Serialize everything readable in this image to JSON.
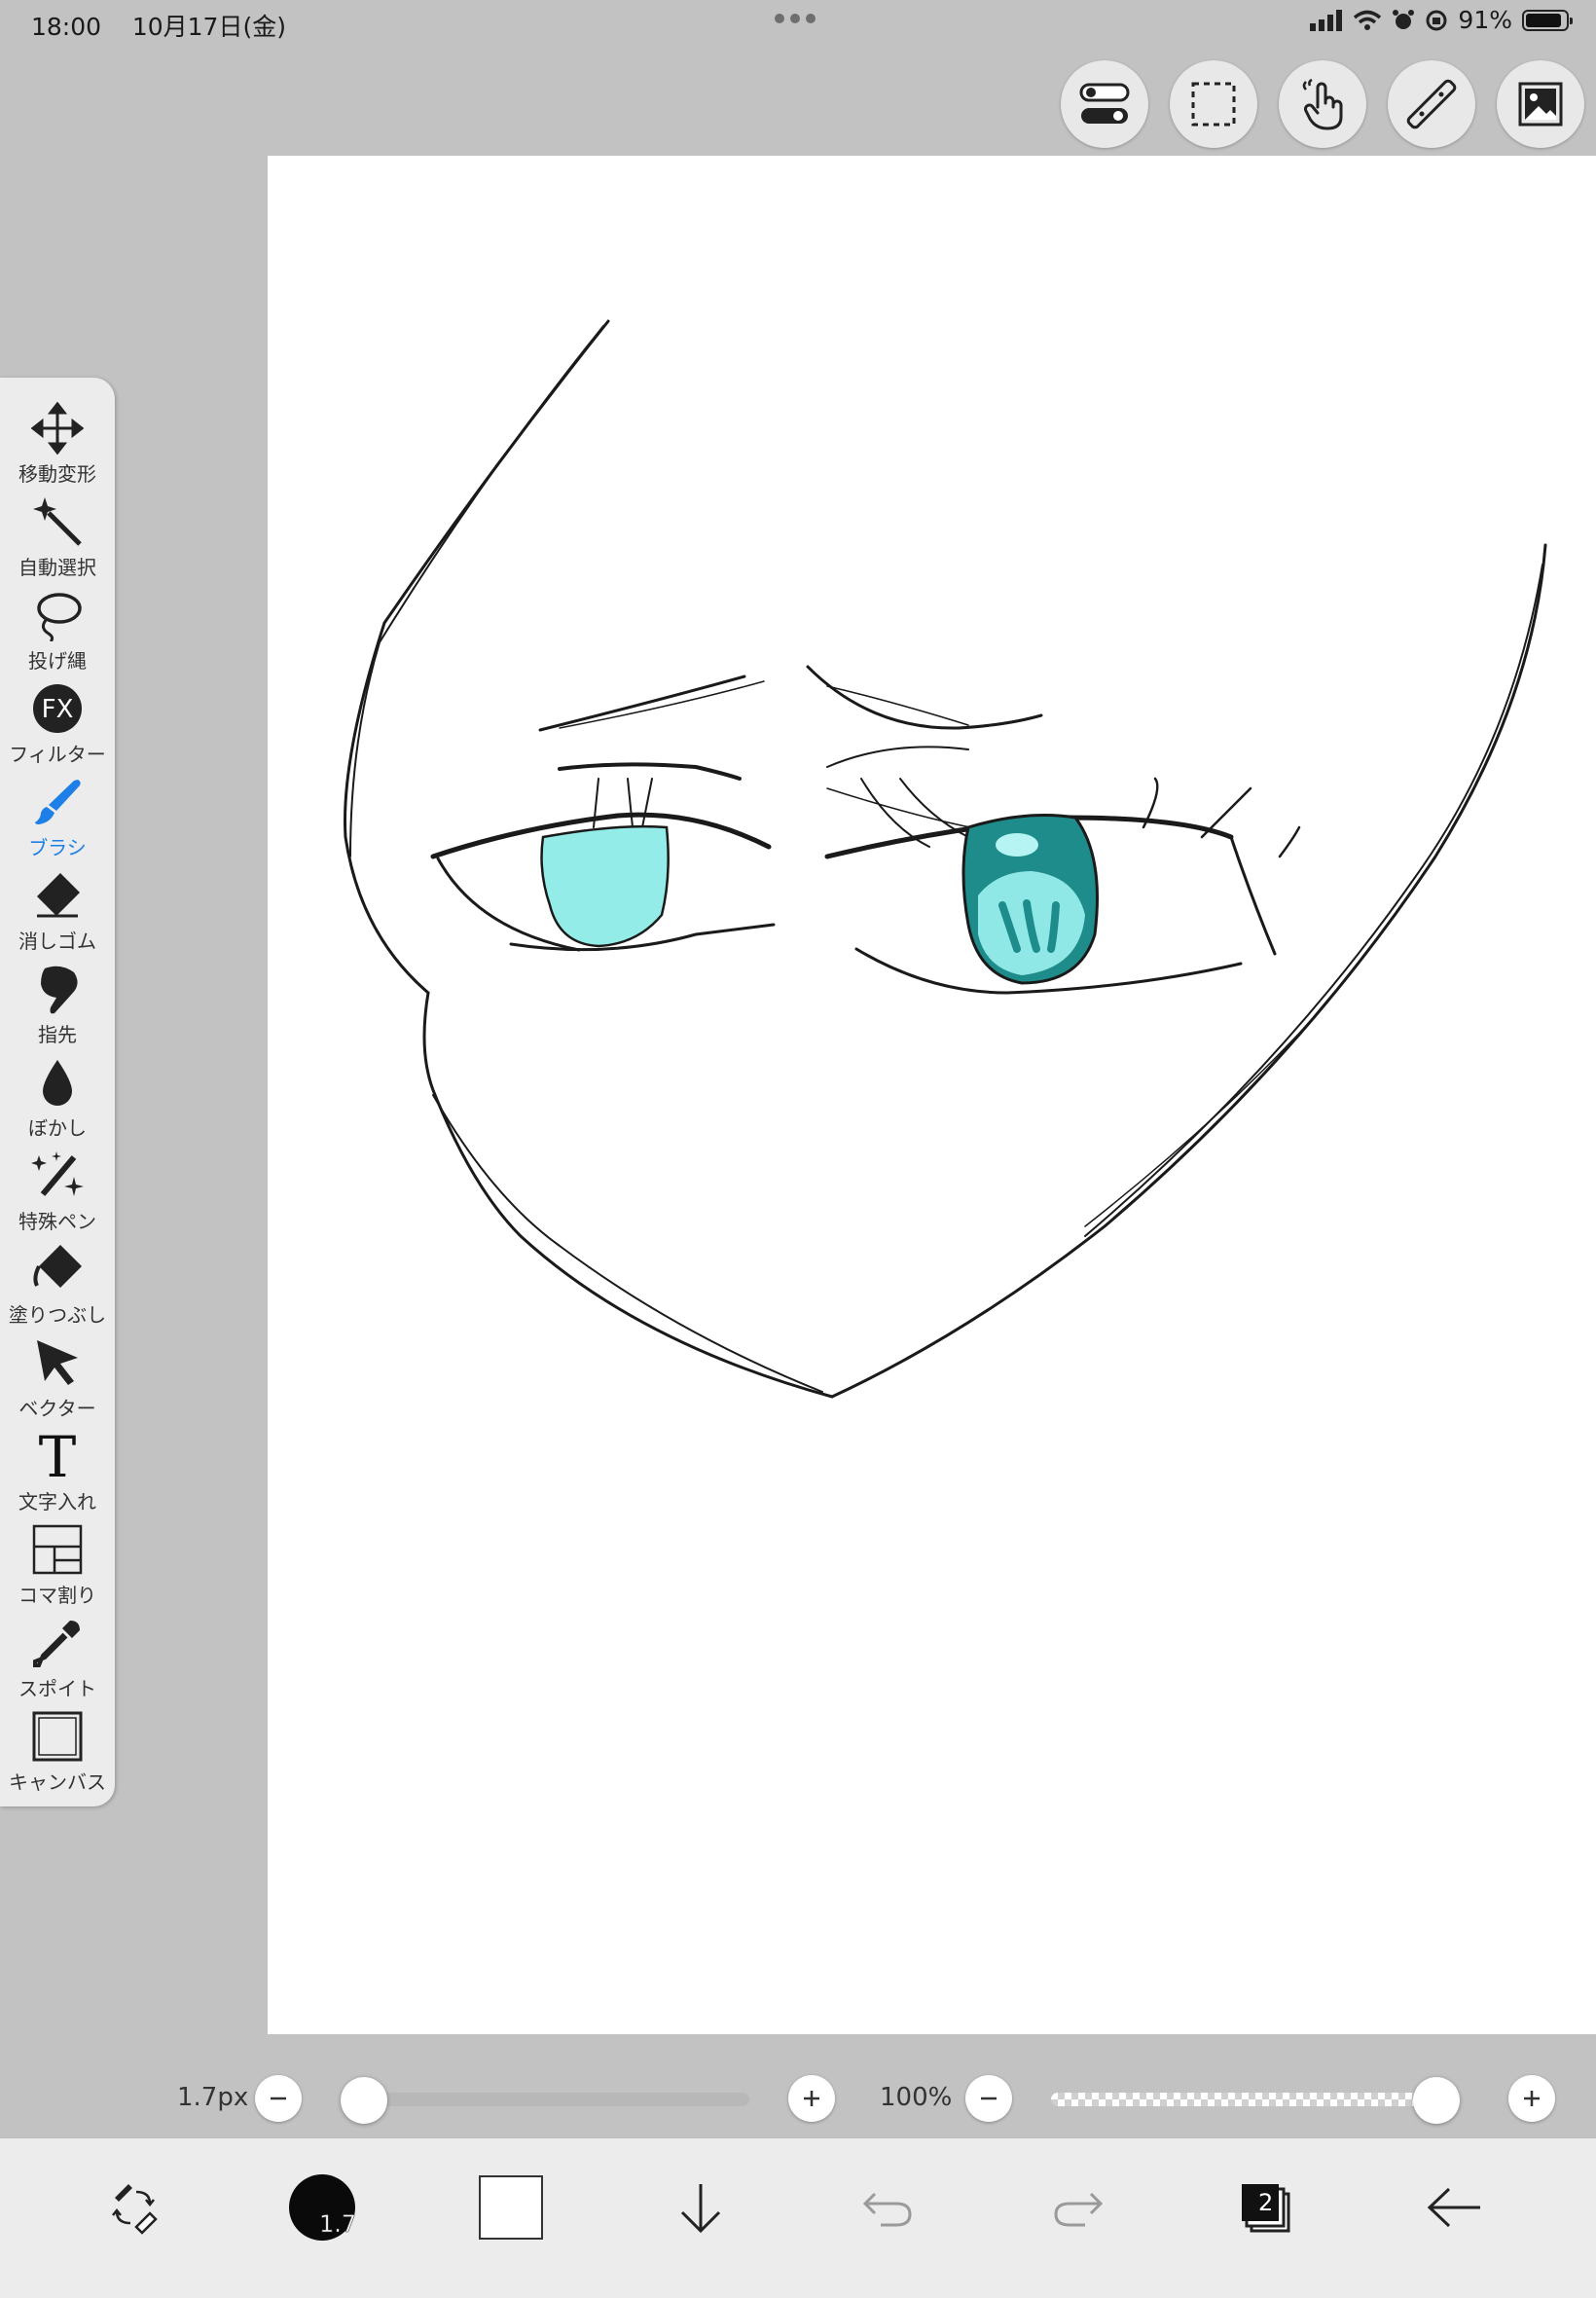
{
  "status": {
    "time": "18:00",
    "date": "10月17日(金)",
    "battery_text": "91%",
    "battery_level": 0.91
  },
  "top_tools": [
    {
      "name": "toggle-settings-icon"
    },
    {
      "name": "selection-marquee-icon"
    },
    {
      "name": "touch-gesture-icon"
    },
    {
      "name": "ruler-icon"
    },
    {
      "name": "image-material-icon"
    }
  ],
  "toolbar": {
    "items": [
      {
        "label": "移動変形",
        "icon": "move-transform-icon"
      },
      {
        "label": "自動選択",
        "icon": "magic-wand-icon"
      },
      {
        "label": "投げ縄",
        "icon": "lasso-icon"
      },
      {
        "label": "フィルター",
        "icon": "fx-filter-icon",
        "icon_text": "FX"
      },
      {
        "label": "ブラシ",
        "icon": "brush-icon",
        "active": true
      },
      {
        "label": "消しゴム",
        "icon": "eraser-icon"
      },
      {
        "label": "指先",
        "icon": "smudge-finger-icon"
      },
      {
        "label": "ぼかし",
        "icon": "blur-drop-icon"
      },
      {
        "label": "特殊ペン",
        "icon": "special-pen-icon"
      },
      {
        "label": "塗りつぶし",
        "icon": "fill-bucket-icon"
      },
      {
        "label": "ベクター",
        "icon": "vector-cursor-icon"
      },
      {
        "label": "文字入れ",
        "icon": "text-icon",
        "icon_text": "T"
      },
      {
        "label": "コマ割り",
        "icon": "panel-layout-icon"
      },
      {
        "label": "スポイト",
        "icon": "eyedropper-icon"
      },
      {
        "label": "キャンバス",
        "icon": "canvas-icon"
      }
    ],
    "active_color": "#1e7fe6"
  },
  "brush_size": {
    "label": "1.7px",
    "level": 0.0
  },
  "opacity": {
    "label": "100%",
    "level": 1.0
  },
  "bottom_bar": {
    "brush_badge": "1.7",
    "layer_count": "2"
  },
  "colors": {
    "accent": "#1e7fe6",
    "eye_left_fill": "#93ece8",
    "eye_right_fill": "#1e8c8a"
  }
}
